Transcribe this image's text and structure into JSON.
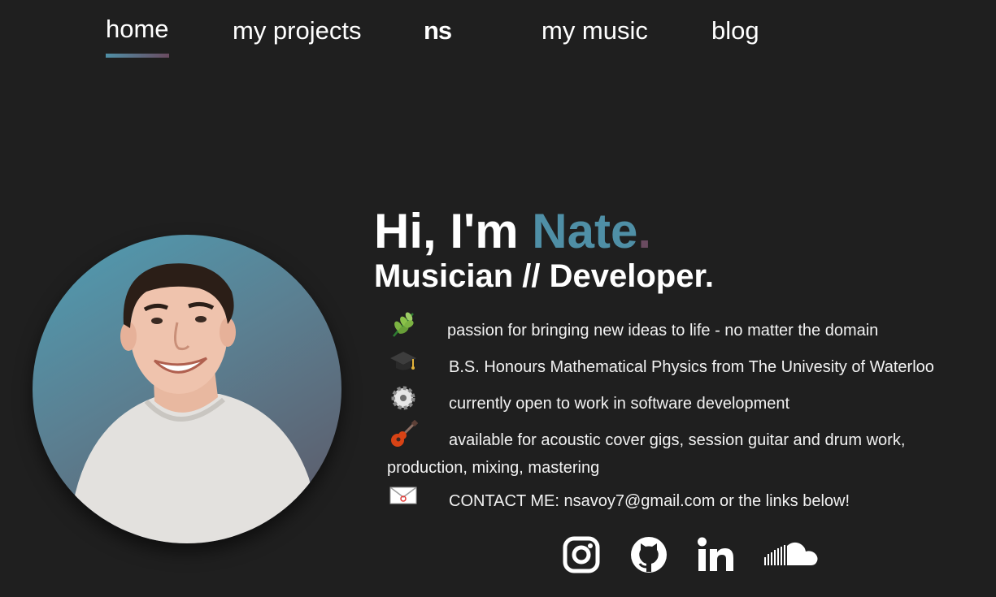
{
  "nav": {
    "home": "home",
    "projects": "my projects",
    "logo": "ns",
    "music": "my music",
    "blog": "blog"
  },
  "hero": {
    "greeting": "Hi, I'm ",
    "name": "Nate",
    "dot": ".",
    "role": "Musician // Developer."
  },
  "facts": [
    {
      "icon": "herb-icon",
      "text": "passion for bringing new ideas to life - no matter the domain"
    },
    {
      "icon": "graduation-cap-icon",
      "text": "B.S. Honours Mathematical Physics from The Univesity of Waterloo"
    },
    {
      "icon": "gear-icon",
      "text": "currently open to work in software development"
    },
    {
      "icon": "guitar-icon",
      "text": "available for acoustic cover gigs, session guitar and drum work,",
      "text2": "production, mixing, mastering"
    },
    {
      "icon": "envelope-icon",
      "text": "CONTACT ME: nsavoy7@gmail.com or the links below!"
    }
  ],
  "social": [
    "instagram-icon",
    "github-icon",
    "linkedin-icon",
    "soundcloud-icon"
  ],
  "colors": {
    "background": "#1f1f1f",
    "accent_teal": "#4f8fa6",
    "accent_plum": "#6a4b60",
    "text": "#ffffff"
  }
}
